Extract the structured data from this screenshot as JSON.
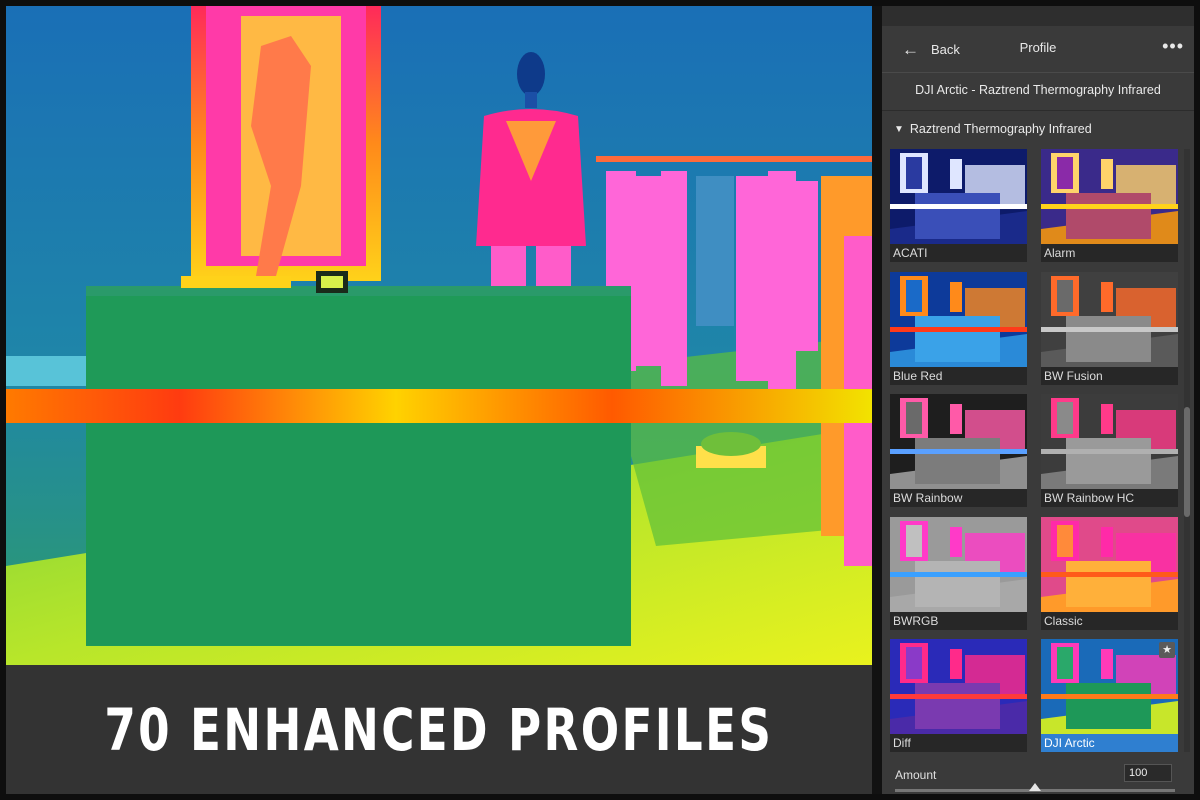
{
  "caption": "70 ENHANCED PROFILES",
  "panel": {
    "back_label": "Back",
    "title": "Profile",
    "more_icon": "more-horizontal-icon",
    "profile_name": "DJI Arctic - Raztrend Thermography Infrared",
    "group_name": "Raztrend Thermography Infrared",
    "thumbnails": [
      {
        "label": "ACATI",
        "style": "acati"
      },
      {
        "label": "Alarm",
        "style": "alarm"
      },
      {
        "label": "Blue Red",
        "style": "bluered"
      },
      {
        "label": "BW Fusion",
        "style": "bwfusion"
      },
      {
        "label": "BW Rainbow",
        "style": "bwrainbow"
      },
      {
        "label": "BW Rainbow HC",
        "style": "bwrainbowhc"
      },
      {
        "label": "BWRGB",
        "style": "bwrgb"
      },
      {
        "label": "Classic",
        "style": "classic"
      },
      {
        "label": "Diff",
        "style": "diff"
      },
      {
        "label": "DJI Arctic",
        "style": "djiarctic",
        "selected": true,
        "favorite": true
      }
    ],
    "amount_label": "Amount",
    "amount_value": "100",
    "amount_fraction": 0.5
  },
  "colors": {
    "selected_accent": "#2f7fd0"
  }
}
